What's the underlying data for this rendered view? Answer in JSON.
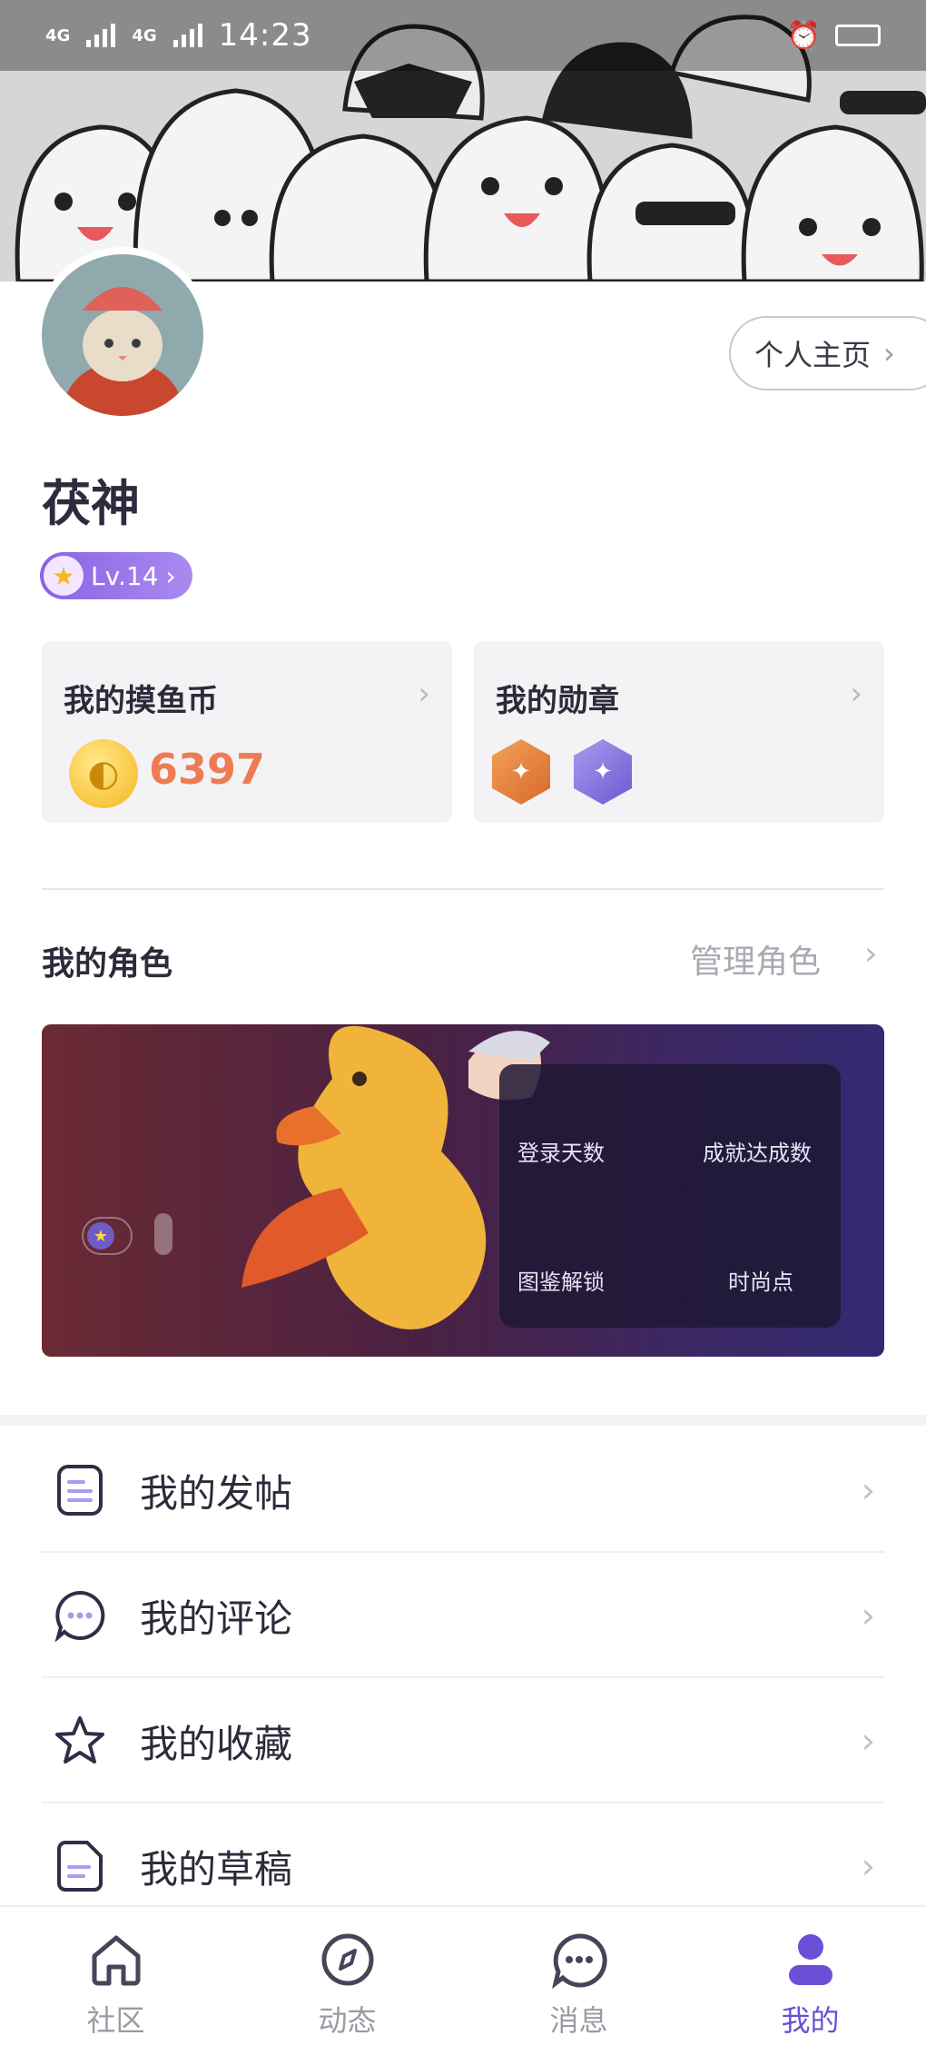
{
  "status_bar": {
    "time": "14:23",
    "signal_1": "4G",
    "signal_2": "4G"
  },
  "profile": {
    "username": "茯神",
    "level": "Lv.14",
    "home_button": "个人主页"
  },
  "cards": {
    "coins": {
      "title": "我的摸鱼币",
      "value": "6397"
    },
    "medals": {
      "title": "我的勋章"
    }
  },
  "role": {
    "title": "我的角色",
    "manage": "管理角色",
    "stats": {
      "login_days": "登录天数",
      "achievements": "成就达成数",
      "collection": "图鉴解锁",
      "fashion": "时尚点"
    }
  },
  "menu": [
    {
      "label": "我的发帖",
      "icon": "document-icon"
    },
    {
      "label": "我的评论",
      "icon": "comment-icon"
    },
    {
      "label": "我的收藏",
      "icon": "star-icon"
    },
    {
      "label": "我的草稿",
      "icon": "draft-icon"
    }
  ],
  "nav": [
    {
      "label": "社区",
      "icon": "home-icon"
    },
    {
      "label": "动态",
      "icon": "compass-icon"
    },
    {
      "label": "消息",
      "icon": "message-icon"
    },
    {
      "label": "我的",
      "icon": "user-icon",
      "active": true
    }
  ],
  "colors": {
    "accent": "#6b4fd6",
    "coin": "#ee7b53",
    "level_badge": "#9a76ea"
  }
}
